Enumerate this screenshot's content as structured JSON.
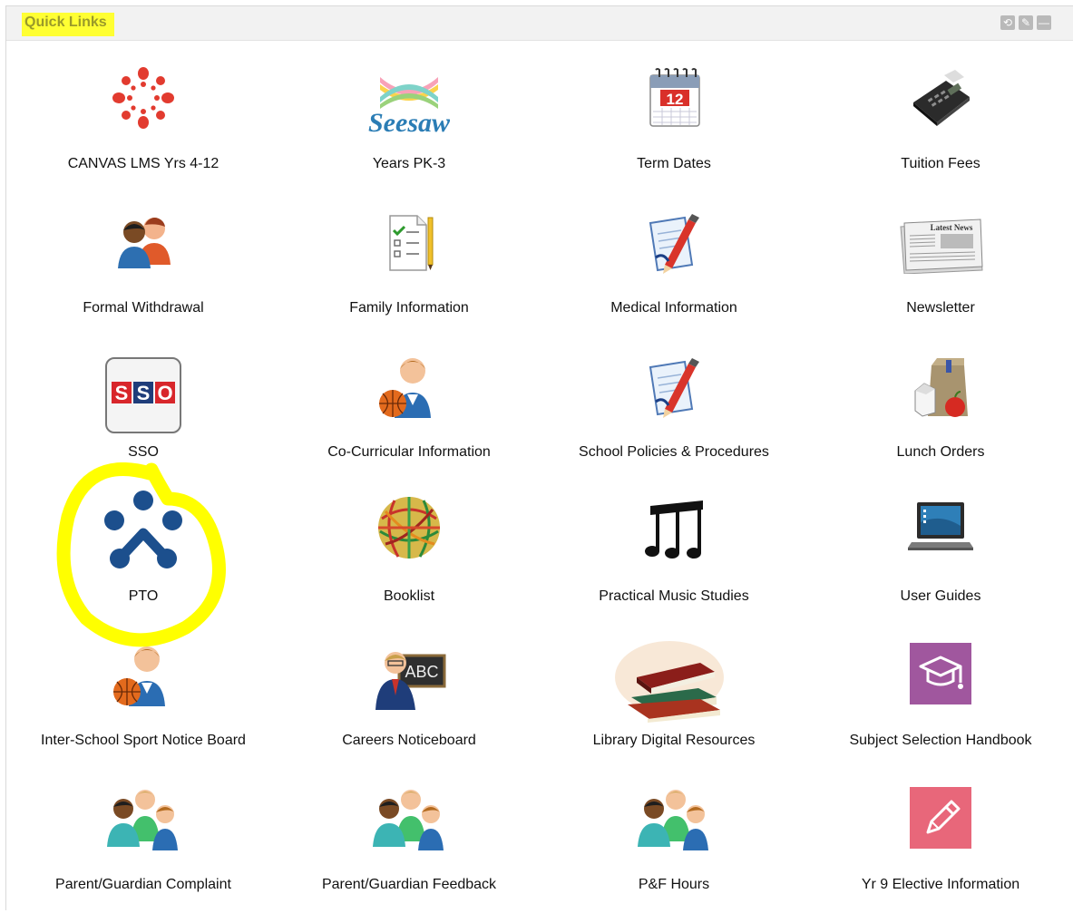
{
  "panel": {
    "title": "Quick Links",
    "controls": [
      "refresh-icon",
      "edit-icon",
      "minimize-icon"
    ]
  },
  "links": [
    {
      "label": "CANVAS LMS Yrs 4-12",
      "icon": "canvas-logo-icon"
    },
    {
      "label": "Years PK-3",
      "icon": "seesaw-logo-icon",
      "logo_text": "Seesaw"
    },
    {
      "label": "Term Dates",
      "icon": "calendar-icon",
      "calendar_day": "12"
    },
    {
      "label": "Tuition Fees",
      "icon": "card-terminal-icon"
    },
    {
      "label": "Formal Withdrawal",
      "icon": "people-icon"
    },
    {
      "label": "Family Information",
      "icon": "checklist-icon"
    },
    {
      "label": "Medical Information",
      "icon": "document-pen-icon"
    },
    {
      "label": "Newsletter",
      "icon": "newspaper-icon",
      "newspaper_heading": "Latest News"
    },
    {
      "label": "SSO",
      "icon": "sso-icon",
      "logo_text": "SSO"
    },
    {
      "label": "Co-Curricular Information",
      "icon": "student-basketball-icon"
    },
    {
      "label": "School Policies & Procedures",
      "icon": "document-pen-icon"
    },
    {
      "label": "Lunch Orders",
      "icon": "lunch-bag-icon"
    },
    {
      "label": "PTO",
      "icon": "pto-logo-icon"
    },
    {
      "label": "Booklist",
      "icon": "rubber-band-ball-icon"
    },
    {
      "label": "Practical Music Studies",
      "icon": "music-notes-icon"
    },
    {
      "label": "User Guides",
      "icon": "laptop-icon"
    },
    {
      "label": "Inter-School Sport Notice Board",
      "icon": "student-basketball-icon"
    },
    {
      "label": "Careers Noticeboard",
      "icon": "teacher-icon",
      "board_text": "ABC"
    },
    {
      "label": "Library Digital Resources",
      "icon": "books-icon"
    },
    {
      "label": "Subject Selection Handbook",
      "icon": "graduation-cap-icon"
    },
    {
      "label": "Parent/Guardian Complaint",
      "icon": "family-icon"
    },
    {
      "label": "Parent/Guardian Feedback",
      "icon": "family-icon"
    },
    {
      "label": "P&F Hours",
      "icon": "family-icon"
    },
    {
      "label": "Yr 9 Elective Information",
      "icon": "pencil-tile-icon"
    }
  ],
  "annotation": {
    "type": "highlight-circle",
    "color": "#ffff00",
    "target": "PTO"
  }
}
